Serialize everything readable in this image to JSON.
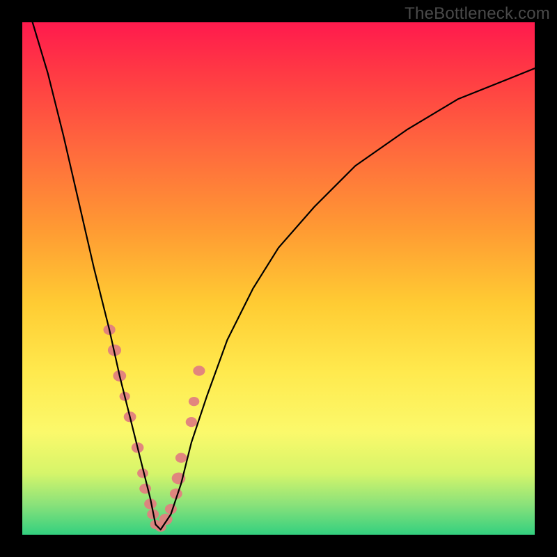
{
  "watermark": "TheBottleneck.com",
  "colors": {
    "curve": "#000000",
    "dot": "#e08080",
    "frame": "#000000"
  },
  "chart_data": {
    "type": "line",
    "title": "",
    "xlabel": "",
    "ylabel": "",
    "xlim": [
      0,
      100
    ],
    "ylim": [
      0,
      100
    ],
    "grid": false,
    "legend": false,
    "note": "Values are approximate, read from the rendered curve. x is horizontal position (0=left,100=right inside the gradient area), y is vertical position (0=bottom,100=top). The curve is a steep V shape with minimum near x≈26.",
    "series": [
      {
        "name": "bottleneck-curve",
        "x": [
          2,
          5,
          8,
          11,
          14,
          17,
          19,
          21,
          23,
          25,
          26,
          27,
          29,
          31,
          33,
          36,
          40,
          45,
          50,
          57,
          65,
          75,
          85,
          95,
          100
        ],
        "y": [
          100,
          90,
          78,
          65,
          52,
          40,
          31,
          23,
          15,
          7,
          2,
          1,
          4,
          10,
          18,
          27,
          38,
          48,
          56,
          64,
          72,
          79,
          85,
          89,
          91
        ]
      }
    ],
    "markers": {
      "name": "highlighted-points",
      "note": "Pink blobs clustered near the bottom of the V and on both arms.",
      "x": [
        17,
        18,
        19,
        20,
        21,
        22.5,
        23.5,
        24,
        25,
        25.5,
        26,
        27,
        28,
        29,
        30,
        30.5,
        31,
        33,
        33.5,
        34.5
      ],
      "y": [
        40,
        36,
        31,
        27,
        23,
        17,
        12,
        9,
        6,
        4,
        2,
        1.5,
        3,
        5,
        8,
        11,
        15,
        22,
        26,
        32
      ]
    }
  }
}
